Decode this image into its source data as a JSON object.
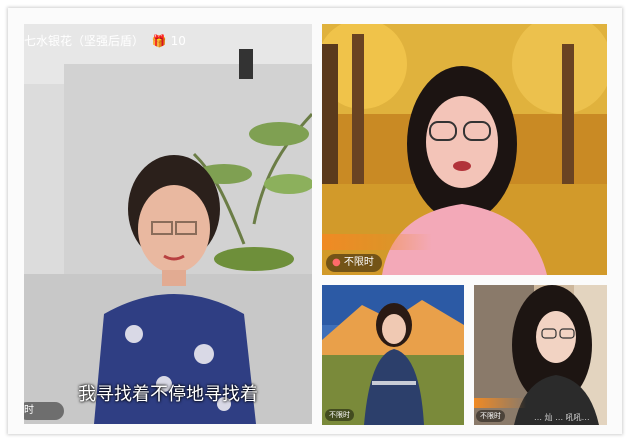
{
  "tiles": {
    "main": {
      "header_text": "七水银花（坚强后盾）",
      "gift_icon": "gift-icon",
      "gift_count": "10",
      "subtitle": "我寻找着不停地寻找着",
      "badge_text": "时"
    },
    "top_right": {
      "badge_text": "不限时"
    },
    "bottom_left": {
      "badge_text": "不限时"
    },
    "bottom_right": {
      "badge_text": "不限时",
      "watermark": "… 灿 …  吼吼…"
    }
  },
  "colors": {
    "accent_orange": "#f08a24",
    "subtitle_text": "#ffffff"
  }
}
